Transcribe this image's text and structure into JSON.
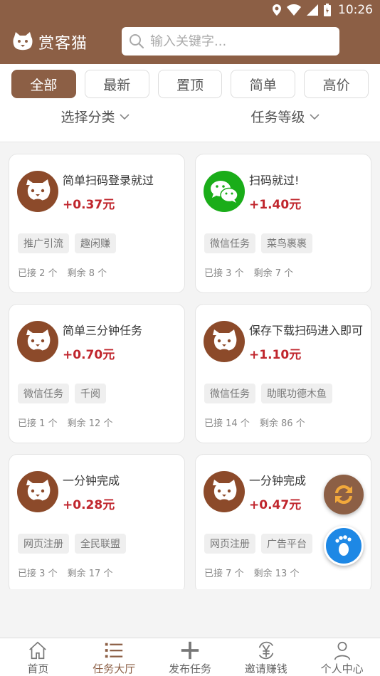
{
  "status_bar": {
    "time": "10:26"
  },
  "header": {
    "brand_name": "赏客猫",
    "search_placeholder": "输入关键字..."
  },
  "filters": {
    "tabs": [
      {
        "label": "全部",
        "active": true
      },
      {
        "label": "最新",
        "active": false
      },
      {
        "label": "置顶",
        "active": false
      },
      {
        "label": "简单",
        "active": false
      },
      {
        "label": "高价",
        "active": false
      }
    ],
    "category_label": "选择分类",
    "level_label": "任务等级"
  },
  "tasks": [
    {
      "title": "简单扫码登录就过",
      "price": "+0.37元",
      "icon": "cat-avatar",
      "tags": [
        "推广引流",
        "趣闲赚"
      ],
      "taken_prefix": "已接",
      "taken": "2",
      "remaining_prefix": "剩余",
      "remaining": "8",
      "unit": "个"
    },
    {
      "title": "扫码就过!",
      "price": "+1.40元",
      "icon": "wechat-icon",
      "tags": [
        "微信任务",
        "菜鸟裹裹"
      ],
      "taken_prefix": "已接",
      "taken": "3",
      "remaining_prefix": "剩余",
      "remaining": "7",
      "unit": "个"
    },
    {
      "title": "简单三分钟任务",
      "price": "+0.70元",
      "icon": "cat-avatar",
      "tags": [
        "微信任务",
        "千阅"
      ],
      "taken_prefix": "已接",
      "taken": "1",
      "remaining_prefix": "剩余",
      "remaining": "12",
      "unit": "个"
    },
    {
      "title": "保存下载扫码进入即可",
      "price": "+1.10元",
      "icon": "cat-avatar",
      "tags": [
        "微信任务",
        "助眠功德木鱼"
      ],
      "taken_prefix": "已接",
      "taken": "14",
      "remaining_prefix": "剩余",
      "remaining": "86",
      "unit": "个"
    },
    {
      "title": "一分钟完成",
      "price": "+0.28元",
      "icon": "cat-avatar",
      "tags": [
        "网页注册",
        "全民联盟"
      ],
      "taken_prefix": "已接",
      "taken": "3",
      "remaining_prefix": "剩余",
      "remaining": "17",
      "unit": "个"
    },
    {
      "title": "一分钟完成",
      "price": "+0.47元",
      "icon": "cat-avatar",
      "tags": [
        "网页注册",
        "广告平台"
      ],
      "taken_prefix": "已接",
      "taken": "7",
      "remaining_prefix": "剩余",
      "remaining": "13",
      "unit": "个"
    }
  ],
  "bottom_nav": [
    {
      "label": "首页",
      "icon": "home-icon",
      "active": false
    },
    {
      "label": "任务大厅",
      "icon": "list-icon",
      "active": true
    },
    {
      "label": "发布任务",
      "icon": "plus-icon",
      "active": false
    },
    {
      "label": "邀请赚钱",
      "icon": "yen-icon",
      "active": false
    },
    {
      "label": "个人中心",
      "icon": "person-icon",
      "active": false
    }
  ],
  "colors": {
    "brand": "#8c5f45",
    "price": "#c0262d",
    "wechat": "#1aad19",
    "fab_blue": "#1e88e5"
  }
}
